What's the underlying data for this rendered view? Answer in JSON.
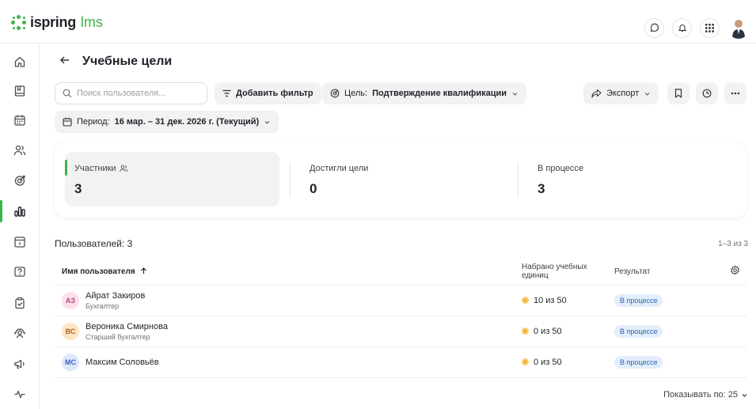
{
  "app": {
    "logo_brand": "ispring",
    "logo_suffix": "lms"
  },
  "header": {
    "title": "Учебные цели"
  },
  "toolbar": {
    "search_placeholder": "Поиск пользователя...",
    "add_filter": "Добавить фильтр",
    "goal_label": "Цель:",
    "goal_value": "Подтверждение квалификации",
    "export": "Экспорт",
    "period_label": "Период:",
    "period_value": "16 мар. – 31 дек. 2026 г. (Текущий)"
  },
  "stats": [
    {
      "label": "Участники",
      "value": "3"
    },
    {
      "label": "Достигли цели",
      "value": "0"
    },
    {
      "label": "В процессе",
      "value": "3"
    }
  ],
  "list": {
    "count_label": "Пользователей: 3",
    "range": "1–3 из 3",
    "columns": {
      "name": "Имя пользователя",
      "points": "Набрано учебных единиц",
      "result": "Результат"
    },
    "rows": [
      {
        "initials": "АЗ",
        "name": "Айрат Закиров",
        "role": "Бухгалтер",
        "points": "10 из 50",
        "result": "В процессе"
      },
      {
        "initials": "ВС",
        "name": "Вероника Смирнова",
        "role": "Старший бухгалтер",
        "points": "0 из 50",
        "result": "В процессе"
      },
      {
        "initials": "МС",
        "name": "Максим Соловьёв",
        "role": "",
        "points": "0 из 50",
        "result": "В процессе"
      }
    ],
    "page_size": "Показывать по: 25"
  },
  "colors": {
    "accent": "#3cb44b",
    "avatar_az_bg": "#fbe0ec",
    "avatar_az_fg": "#c2447a",
    "avatar_vs_bg": "#fde6c8",
    "avatar_vs_fg": "#a8641a",
    "avatar_ms_bg": "#dde7fb",
    "avatar_ms_fg": "#3b64c4",
    "badge_bg": "#e3eefc",
    "badge_fg": "#2f5fae",
    "coin": "#f4b63a"
  },
  "icons": {
    "sidebar": [
      "home-icon",
      "book-icon",
      "calendar-icon",
      "users-icon",
      "target-icon",
      "chart-icon",
      "archive-icon",
      "help-icon",
      "clipboard-icon",
      "support-icon",
      "megaphone-icon",
      "activity-icon"
    ],
    "top": [
      "chat-icon",
      "bell-icon",
      "apps-grid-icon",
      "avatar"
    ]
  }
}
